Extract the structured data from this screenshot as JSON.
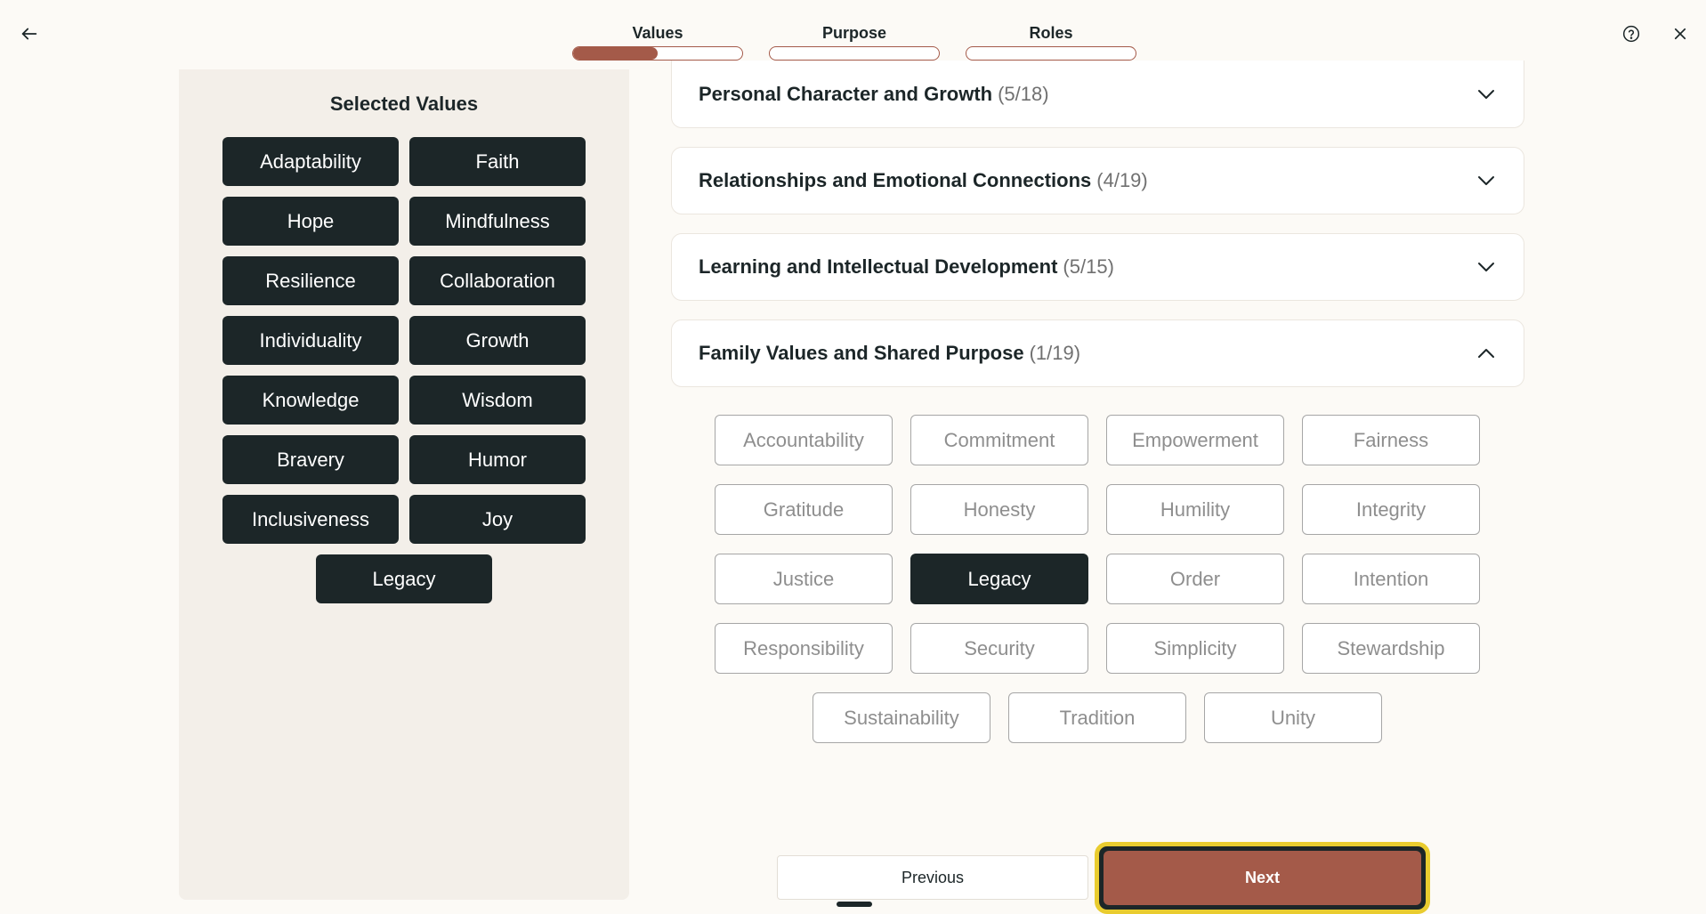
{
  "colors": {
    "accent": "#a45a49",
    "chip_dark": "#1c2628",
    "focus_ring": "#e9cc2f"
  },
  "header": {
    "back_icon": "arrow-left-icon",
    "help_icon": "question-circle-icon",
    "close_icon": "close-icon",
    "steps": [
      {
        "label": "Values",
        "progress": 0.5
      },
      {
        "label": "Purpose",
        "progress": 0
      },
      {
        "label": "Roles",
        "progress": 0
      }
    ]
  },
  "selected": {
    "title": "Selected Values",
    "values": [
      "Adaptability",
      "Faith",
      "Hope",
      "Mindfulness",
      "Resilience",
      "Collaboration",
      "Individuality",
      "Growth",
      "Knowledge",
      "Wisdom",
      "Bravery",
      "Humor",
      "Inclusiveness",
      "Joy",
      "Legacy"
    ]
  },
  "categories": [
    {
      "title": "Personal Character and Growth",
      "count": "(5/18)",
      "expanded": false
    },
    {
      "title": "Relationships and Emotional Connections",
      "count": "(4/19)",
      "expanded": false
    },
    {
      "title": "Learning and Intellectual Development",
      "count": "(5/15)",
      "expanded": false
    },
    {
      "title": "Family Values and Shared Purpose",
      "count": "(1/19)",
      "expanded": true
    }
  ],
  "options": [
    {
      "label": "Accountability",
      "selected": false
    },
    {
      "label": "Commitment",
      "selected": false
    },
    {
      "label": "Empowerment",
      "selected": false
    },
    {
      "label": "Fairness",
      "selected": false
    },
    {
      "label": "Gratitude",
      "selected": false
    },
    {
      "label": "Honesty",
      "selected": false
    },
    {
      "label": "Humility",
      "selected": false
    },
    {
      "label": "Integrity",
      "selected": false
    },
    {
      "label": "Justice",
      "selected": false
    },
    {
      "label": "Legacy",
      "selected": true
    },
    {
      "label": "Order",
      "selected": false
    },
    {
      "label": "Intention",
      "selected": false
    },
    {
      "label": "Responsibility",
      "selected": false
    },
    {
      "label": "Security",
      "selected": false
    },
    {
      "label": "Simplicity",
      "selected": false
    },
    {
      "label": "Stewardship",
      "selected": false
    },
    {
      "label": "Sustainability",
      "selected": false
    },
    {
      "label": "Tradition",
      "selected": false
    },
    {
      "label": "Unity",
      "selected": false
    }
  ],
  "footer": {
    "previous_label": "Previous",
    "next_label": "Next"
  }
}
